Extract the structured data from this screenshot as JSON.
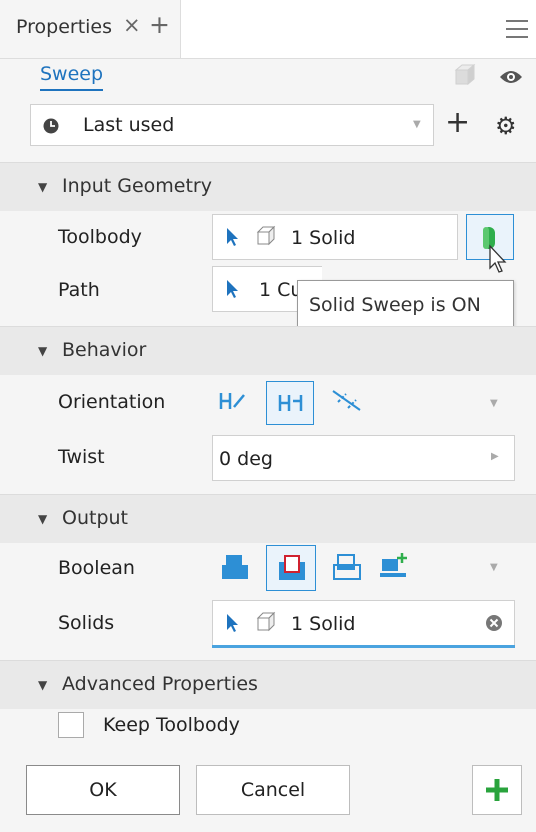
{
  "tabs": {
    "properties_label": "Properties",
    "close_glyph": "×",
    "add_glyph": "+"
  },
  "feature": {
    "name": "Sweep"
  },
  "preset": {
    "value": "Last used",
    "add_glyph": "+"
  },
  "sections": {
    "input_geometry": {
      "title": "Input Geometry",
      "toolbody_label": "Toolbody",
      "toolbody_value": "1 Solid",
      "path_label": "Path",
      "path_value": "1 Cu"
    },
    "behavior": {
      "title": "Behavior",
      "orientation_label": "Orientation",
      "twist_label": "Twist",
      "twist_value": "0 deg"
    },
    "output": {
      "title": "Output",
      "boolean_label": "Boolean",
      "solids_label": "Solids",
      "solids_value": "1 Solid"
    },
    "advanced": {
      "title": "Advanced Properties",
      "keep_toolbody_label": "Keep Toolbody",
      "keep_toolbody_checked": false
    }
  },
  "tooltip": {
    "text": "Solid Sweep is ON"
  },
  "buttons": {
    "ok": "OK",
    "cancel": "Cancel"
  },
  "colors": {
    "accent_blue": "#1e73be",
    "selection_blue": "#2d8fd5",
    "solid_green": "#2fae4c",
    "add_green": "#29a33c"
  },
  "icons": [
    "menu-icon",
    "cube-icon",
    "eye-icon",
    "clock-icon",
    "gear-icon",
    "cursor-icon",
    "solid-sweep-icon",
    "orientation-path-icon",
    "orientation-fixed-icon",
    "orientation-guide-icon",
    "join-icon",
    "cut-icon",
    "intersect-icon",
    "new-solid-icon",
    "clear-icon",
    "plus-icon"
  ]
}
